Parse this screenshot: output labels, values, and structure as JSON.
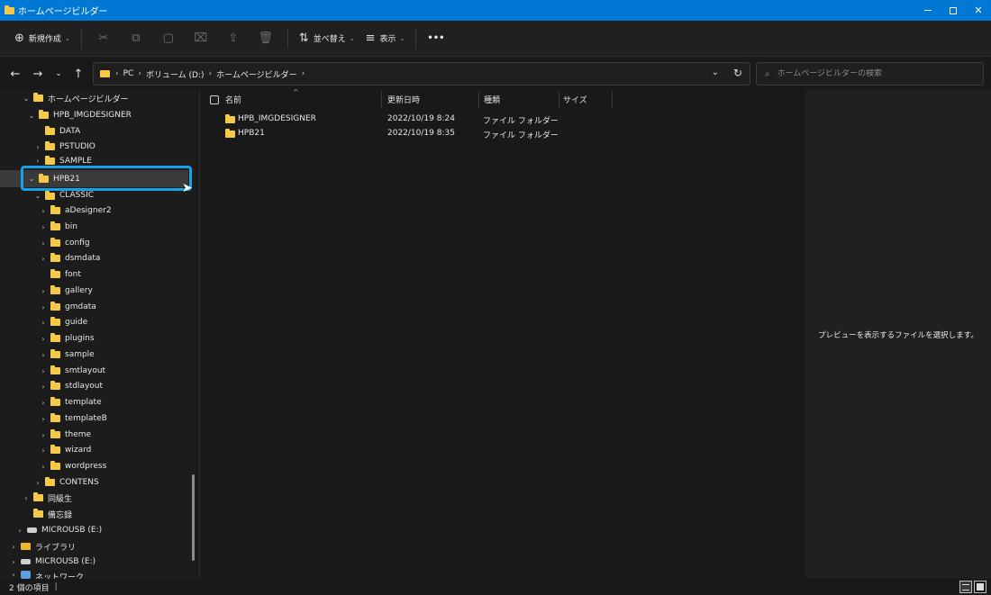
{
  "window": {
    "title": "ホームページビルダー",
    "accent_color": "#0078d4"
  },
  "toolbar": {
    "new_label": "新規作成",
    "sort_label": "並べ替え",
    "view_label": "表示",
    "more_label": "•••"
  },
  "address": {
    "crumbs": [
      "PC",
      "ボリューム (D:)",
      "ホームページビルダー"
    ]
  },
  "search": {
    "placeholder": "ホームページビルダーの検索"
  },
  "nav_tree": {
    "items": [
      {
        "label": "ホームページビルダー",
        "chev": "⌄"
      },
      {
        "label": "HPB_IMGDESIGNER",
        "chev": "⌄"
      },
      {
        "label": "DATA",
        "chev": ""
      },
      {
        "label": "PSTUDIO",
        "chev": "›"
      },
      {
        "label": "SAMPLE",
        "chev": "›"
      },
      {
        "label": "HPB21",
        "chev": "⌄"
      },
      {
        "label": "CLASSIC",
        "chev": "⌄"
      },
      {
        "label": "aDesigner2",
        "chev": "›"
      },
      {
        "label": "bin",
        "chev": "›"
      },
      {
        "label": "config",
        "chev": "›"
      },
      {
        "label": "dsmdata",
        "chev": "›"
      },
      {
        "label": "font",
        "chev": ""
      },
      {
        "label": "gallery",
        "chev": "›"
      },
      {
        "label": "gmdata",
        "chev": "›"
      },
      {
        "label": "guide",
        "chev": "›"
      },
      {
        "label": "plugins",
        "chev": "›"
      },
      {
        "label": "sample",
        "chev": "›"
      },
      {
        "label": "smtlayout",
        "chev": "›"
      },
      {
        "label": "stdlayout",
        "chev": "›"
      },
      {
        "label": "template",
        "chev": "›"
      },
      {
        "label": "templateB",
        "chev": "›"
      },
      {
        "label": "theme",
        "chev": "›"
      },
      {
        "label": "wizard",
        "chev": "›"
      },
      {
        "label": "wordpress",
        "chev": "›"
      },
      {
        "label": "CONTENS",
        "chev": "›"
      },
      {
        "label": "同級生",
        "chev": "›"
      },
      {
        "label": "備忘録",
        "chev": ""
      },
      {
        "label": "MICROUSB (E:)",
        "chev": "›"
      },
      {
        "label": "ライブラリ",
        "chev": "›"
      },
      {
        "label": "MICROUSB (E:)",
        "chev": "›"
      },
      {
        "label": "ネットワーク",
        "chev": "›"
      }
    ]
  },
  "file_list": {
    "columns": [
      "名前",
      "更新日時",
      "種類",
      "サイズ"
    ],
    "rows": [
      {
        "name": "HPB_IMGDESIGNER",
        "modified": "2022/10/19 8:24",
        "type": "ファイル フォルダー",
        "size": ""
      },
      {
        "name": "HPB21",
        "modified": "2022/10/19 8:35",
        "type": "ファイル フォルダー",
        "size": ""
      }
    ]
  },
  "preview": {
    "message": "プレビューを表示するファイルを選択します。"
  },
  "status": {
    "item_count": "2 個の項目",
    "pipe": "|"
  }
}
